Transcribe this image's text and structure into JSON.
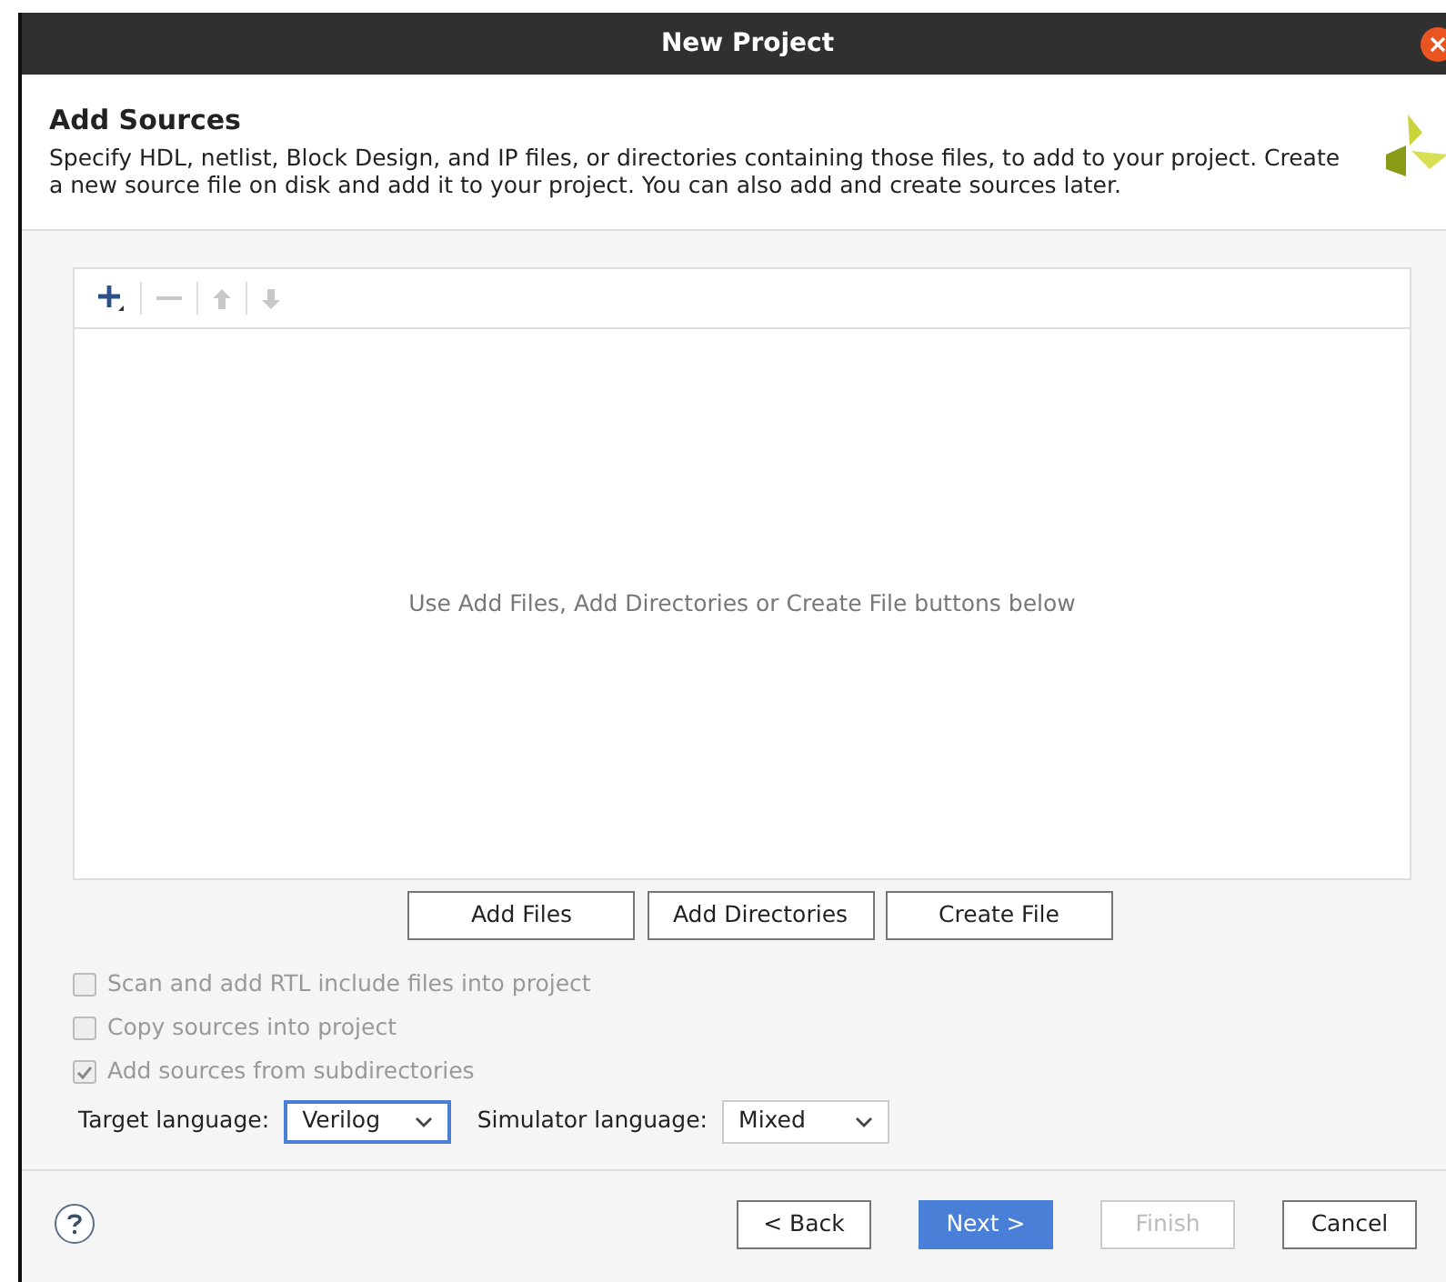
{
  "window": {
    "title": "New Project"
  },
  "header": {
    "title": "Add Sources",
    "description": "Specify HDL, netlist, Block Design, and IP files, or directories containing those files, to add to your project. Create a new source file on disk and add it to your project. You can also add and create sources later."
  },
  "toolbar": [
    {
      "kind": "add",
      "disabled": false
    },
    {
      "kind": "remove",
      "disabled": true
    },
    {
      "kind": "up",
      "disabled": true
    },
    {
      "kind": "down",
      "disabled": true
    }
  ],
  "file_list": {
    "empty_message": "Use Add Files, Add Directories or Create File buttons below"
  },
  "source_buttons": [
    {
      "label": "Add Files"
    },
    {
      "label": "Add Directories"
    },
    {
      "label": "Create File"
    }
  ],
  "options": [
    {
      "label": "Scan and add RTL include files into project",
      "checked": false,
      "disabled": true
    },
    {
      "label": "Copy sources into project",
      "checked": false,
      "disabled": true
    },
    {
      "label": "Add sources from subdirectories",
      "checked": true,
      "disabled": true
    }
  ],
  "target_language": {
    "label": "Target language:",
    "value": "Verilog"
  },
  "simulator_language": {
    "label": "Simulator language:",
    "value": "Mixed"
  },
  "footer_buttons": [
    {
      "label": "< Back",
      "kind": "normal",
      "disabled": false
    },
    {
      "label": "Next >",
      "kind": "primary",
      "disabled": false
    },
    {
      "label": "Finish",
      "kind": "normal",
      "disabled": true
    },
    {
      "label": "Cancel",
      "kind": "normal",
      "disabled": false
    }
  ]
}
